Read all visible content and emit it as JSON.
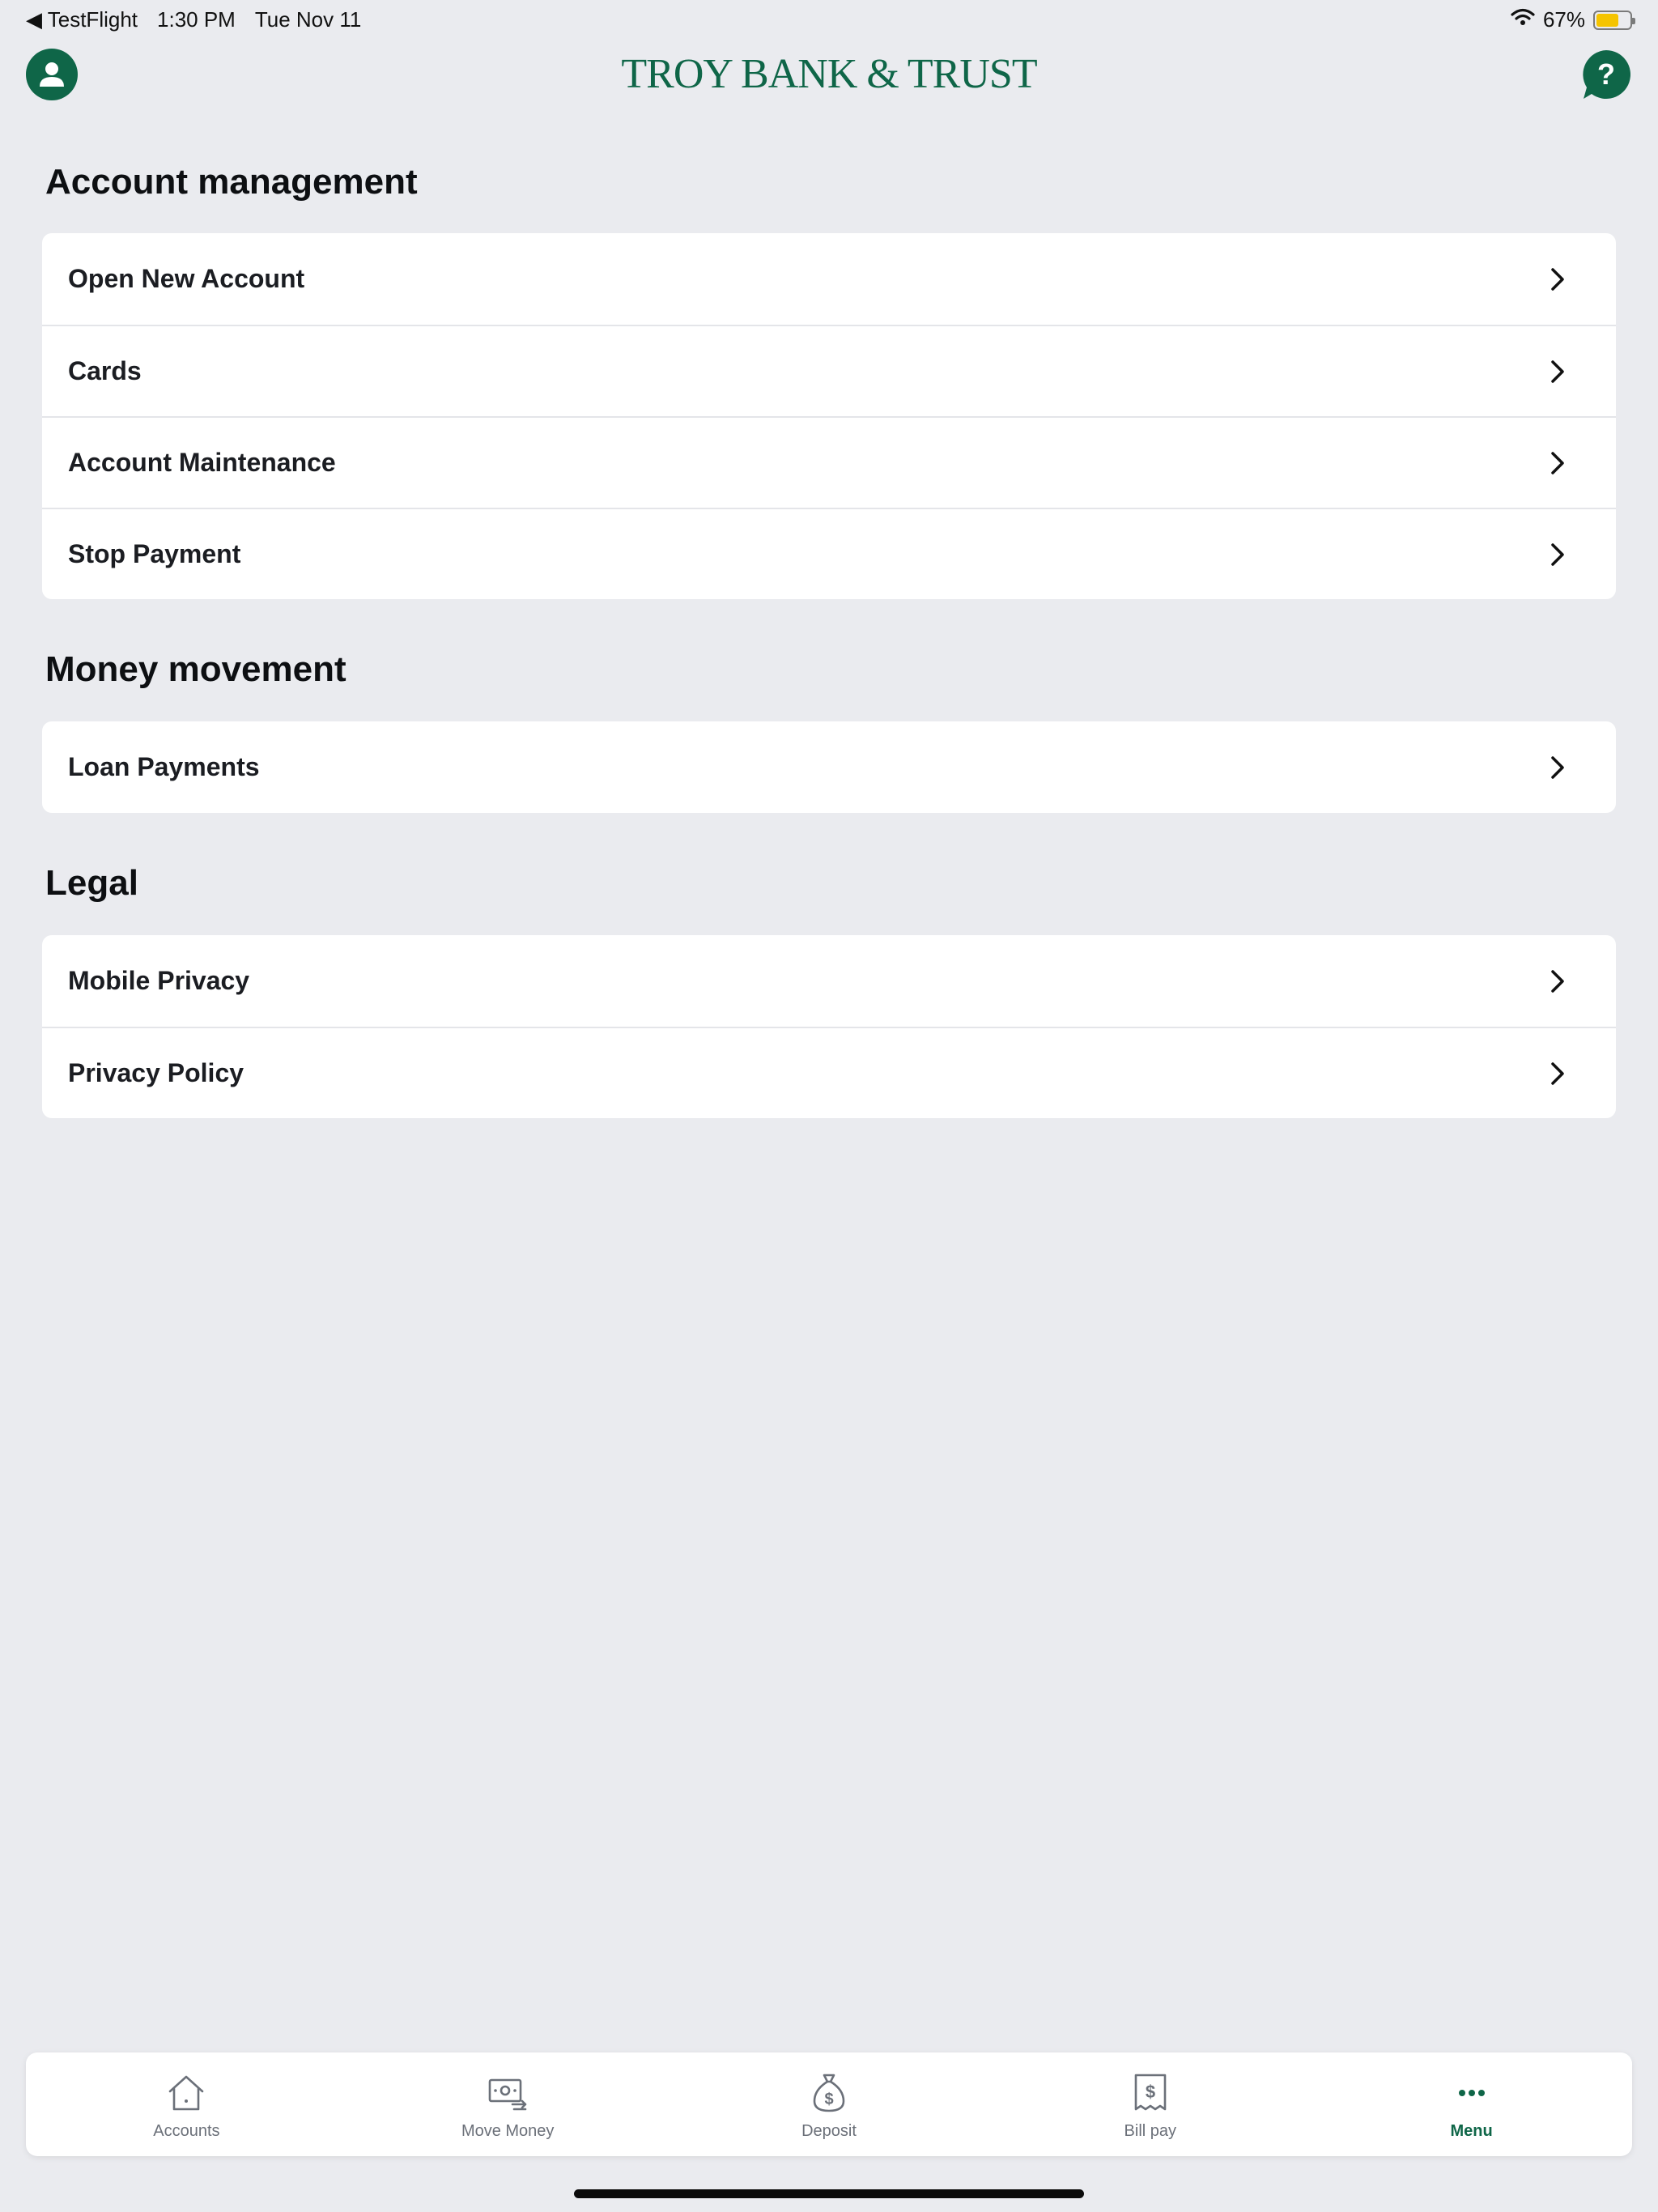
{
  "status_bar": {
    "back_app": "◀ TestFlight",
    "time": "1:30 PM",
    "date": "Tue Nov 11",
    "battery": "67%",
    "battery_level": 0.67
  },
  "header": {
    "logo": "TROY BANK & TRUST",
    "profile_icon": "person-icon",
    "help_icon": "question-bubble-icon"
  },
  "sections": [
    {
      "title": "Account management",
      "items": [
        "Open New Account",
        "Cards",
        "Account Maintenance",
        "Stop Payment"
      ]
    },
    {
      "title": "Money movement",
      "items": [
        "Loan Payments"
      ]
    },
    {
      "title": "Legal",
      "items": [
        "Mobile Privacy",
        "Privacy Policy"
      ]
    }
  ],
  "tabs": [
    {
      "label": "Accounts",
      "icon": "home-icon"
    },
    {
      "label": "Move Money",
      "icon": "money-transfer-icon"
    },
    {
      "label": "Deposit",
      "icon": "money-bag-icon"
    },
    {
      "label": "Bill pay",
      "icon": "bill-icon"
    },
    {
      "label": "Menu",
      "icon": "more-dots-icon",
      "active": true
    }
  ],
  "colors": {
    "brand_green": "#0f6648",
    "background": "#eaebef",
    "battery_fill": "#f5c400"
  }
}
